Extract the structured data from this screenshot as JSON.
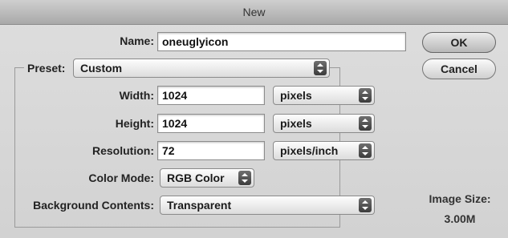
{
  "window": {
    "title": "New"
  },
  "name": {
    "label": "Name:",
    "value": "oneuglyicon"
  },
  "preset": {
    "label": "Preset:",
    "value": "Custom"
  },
  "width": {
    "label": "Width:",
    "value": "1024",
    "unit": "pixels"
  },
  "height": {
    "label": "Height:",
    "value": "1024",
    "unit": "pixels"
  },
  "resolution": {
    "label": "Resolution:",
    "value": "72",
    "unit": "pixels/inch"
  },
  "color_mode": {
    "label": "Color Mode:",
    "value": "RGB Color"
  },
  "background": {
    "label": "Background Contents:",
    "value": "Transparent"
  },
  "buttons": {
    "ok": "OK",
    "cancel": "Cancel"
  },
  "image_size": {
    "label": "Image Size:",
    "value": "3.00M"
  },
  "icons": {
    "popup_arrow": "up-down-arrows-icon"
  }
}
